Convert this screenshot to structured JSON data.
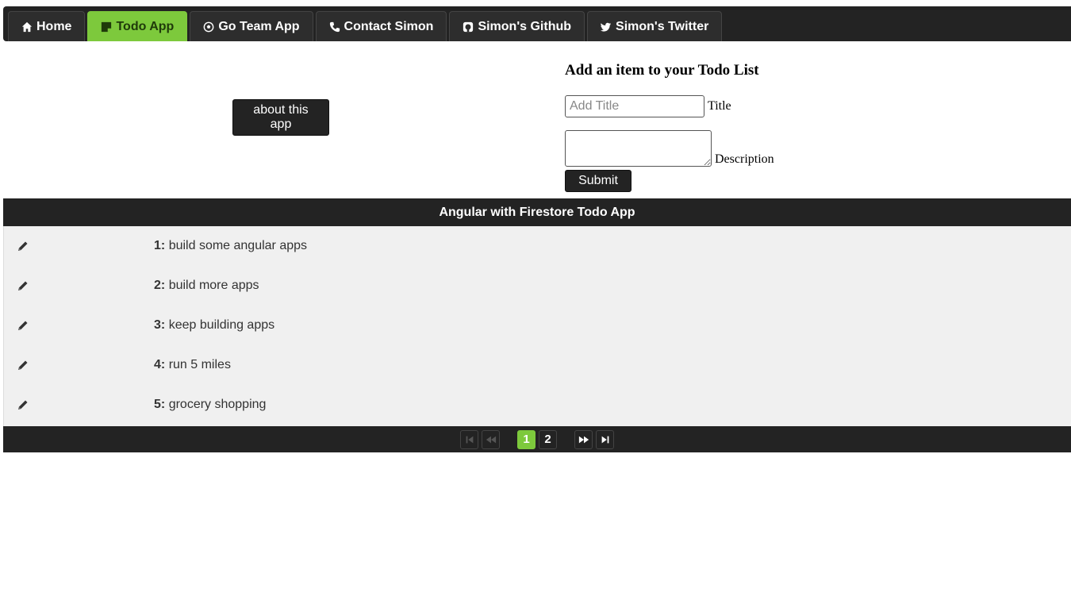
{
  "nav": {
    "items": [
      {
        "label": "Home",
        "icon": "home-icon",
        "active": false
      },
      {
        "label": "Todo App",
        "icon": "sticky-note-icon",
        "active": true
      },
      {
        "label": "Go Team App",
        "icon": "soccer-ball-icon",
        "active": false
      },
      {
        "label": "Contact Simon",
        "icon": "phone-icon",
        "active": false
      },
      {
        "label": "Simon's Github",
        "icon": "github-icon",
        "active": false
      },
      {
        "label": "Simon's Twitter",
        "icon": "twitter-icon",
        "active": false
      }
    ],
    "active_color": "#7dc93c"
  },
  "about_button": {
    "label": "about this app"
  },
  "form": {
    "heading": "Add an item to your Todo List",
    "title_placeholder": "Add Title",
    "title_label": "Title",
    "description_label": "Description",
    "submit_label": "Submit"
  },
  "table": {
    "header": "Angular with Firestore Todo App",
    "rows": [
      {
        "num": "1:",
        "text": "build some angular apps"
      },
      {
        "num": "2:",
        "text": "build more apps"
      },
      {
        "num": "3:",
        "text": "keep building apps"
      },
      {
        "num": "4:",
        "text": "run 5 miles"
      },
      {
        "num": "5:",
        "text": "grocery shopping"
      }
    ]
  },
  "paginator": {
    "pages": [
      "1",
      "2"
    ],
    "current_page": "1"
  },
  "colors": {
    "dark": "#232323",
    "accent": "#7dc93c",
    "row_bg": "#f0f0f0"
  }
}
